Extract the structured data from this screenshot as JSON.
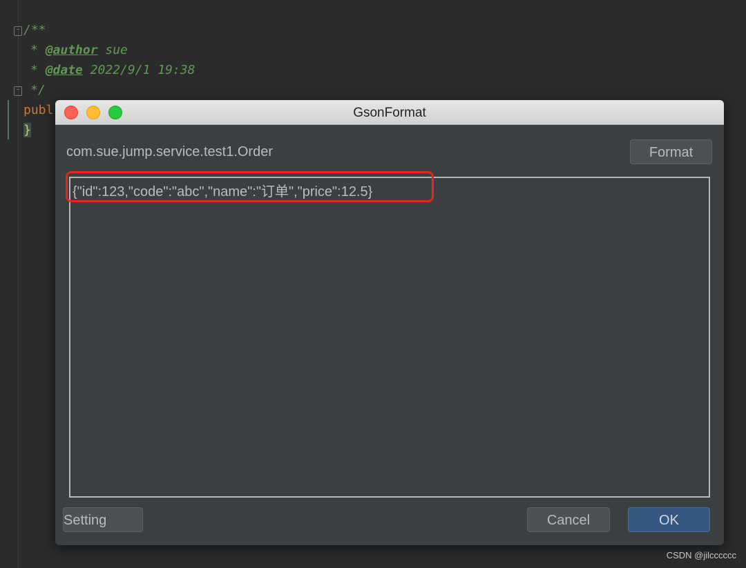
{
  "editor": {
    "lines": [
      "/**",
      "* ",
      "@author",
      " sue",
      "* ",
      "@date",
      " 2022/9/1 19:38",
      "*/"
    ],
    "keyword": "publ",
    "brace": "}"
  },
  "dialog": {
    "title": "GsonFormat",
    "class_name": "com.sue.jump.service.test1.Order",
    "format_label": "Format",
    "json_value": "{\"id\":123,\"code\":\"abc\",\"name\":\"订单\",\"price\":12.5}",
    "setting_label": "Setting",
    "cancel_label": "Cancel",
    "ok_label": "OK",
    "highlight_color": "#e6261c",
    "ok_color": "#365880"
  },
  "watermark": "CSDN @jilcccccc"
}
